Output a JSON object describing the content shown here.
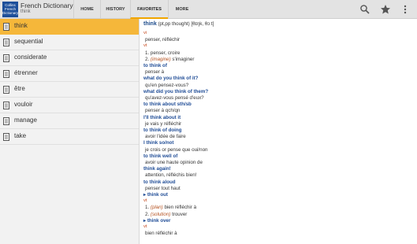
{
  "header": {
    "logo": [
      "Collins",
      "French",
      "Dictionary"
    ],
    "app_title": "French Dictionary",
    "subtitle": "think",
    "tabs": [
      "HOME",
      "HISTORY",
      "FAVORITES",
      "MORE"
    ],
    "active_tab": "FAVORITES",
    "icons": [
      "search-icon",
      "star-icon",
      "overflow-menu-icon"
    ]
  },
  "sidebar": {
    "items": [
      {
        "label": "think",
        "selected": true
      },
      {
        "label": "sequential"
      },
      {
        "label": "considerate"
      },
      {
        "label": "étrenner"
      },
      {
        "label": "être"
      },
      {
        "label": "vouloir"
      },
      {
        "label": "manage"
      },
      {
        "label": "take"
      }
    ]
  },
  "entry": {
    "headword": "think",
    "inflection": "(pt,pp thought)",
    "pronunciation": "[θɪŋk, θɔːt]",
    "lines": [
      {
        "t": "vi",
        "k": "pos"
      },
      {
        "t": "penser, réfléchir",
        "k": "plain"
      },
      {
        "t": "vt",
        "k": "pos"
      },
      {
        "t": "1.",
        "k": "num",
        "t2": "penser, croire"
      },
      {
        "t": "2.",
        "k": "num",
        "it": "(imagine)",
        "t2": "s'imaginer"
      },
      {
        "t": "to think of",
        "k": "phr"
      },
      {
        "t": "penser à",
        "k": "plain"
      },
      {
        "t": "what do you think of it?",
        "k": "phr"
      },
      {
        "t": "qu'en pensez-vous?",
        "k": "plain"
      },
      {
        "t": "what did you think of them?",
        "k": "phr"
      },
      {
        "t": "qu'avez-vous pensé d'eux?",
        "k": "plain"
      },
      {
        "t": "to think about sth/sb",
        "k": "phr"
      },
      {
        "t": "penser à qch/qn",
        "k": "plain"
      },
      {
        "t": "I'll think about it",
        "k": "phr"
      },
      {
        "t": "je vais y réfléchir",
        "k": "plain"
      },
      {
        "t": "to think of doing",
        "k": "phr"
      },
      {
        "t": "avoir l'idée de faire",
        "k": "plain"
      },
      {
        "t": "I think so/not",
        "k": "phr"
      },
      {
        "t": "je crois or pense que oui/non",
        "k": "plain"
      },
      {
        "t": "to think well of",
        "k": "phr"
      },
      {
        "t": "avoir une haute opinion de",
        "k": "plain"
      },
      {
        "t": "think again!",
        "k": "phr"
      },
      {
        "t": "attention, réfléchis bien!",
        "k": "plain"
      },
      {
        "t": "to think aloud",
        "k": "phr"
      },
      {
        "t": "penser tout haut",
        "k": "plain"
      },
      {
        "t": "▸ think out",
        "k": "xref"
      },
      {
        "t": "vt",
        "k": "pos"
      },
      {
        "t": "1.",
        "k": "num",
        "it": "(plan)",
        "t2": "bien réfléchir à"
      },
      {
        "t": "2.",
        "k": "num",
        "it": "(solution)",
        "t2": "trouver"
      },
      {
        "t": "▸ think over",
        "k": "xref"
      },
      {
        "t": "vt",
        "k": "pos"
      },
      {
        "t": "bien réfléchir à",
        "k": "plain"
      }
    ]
  }
}
